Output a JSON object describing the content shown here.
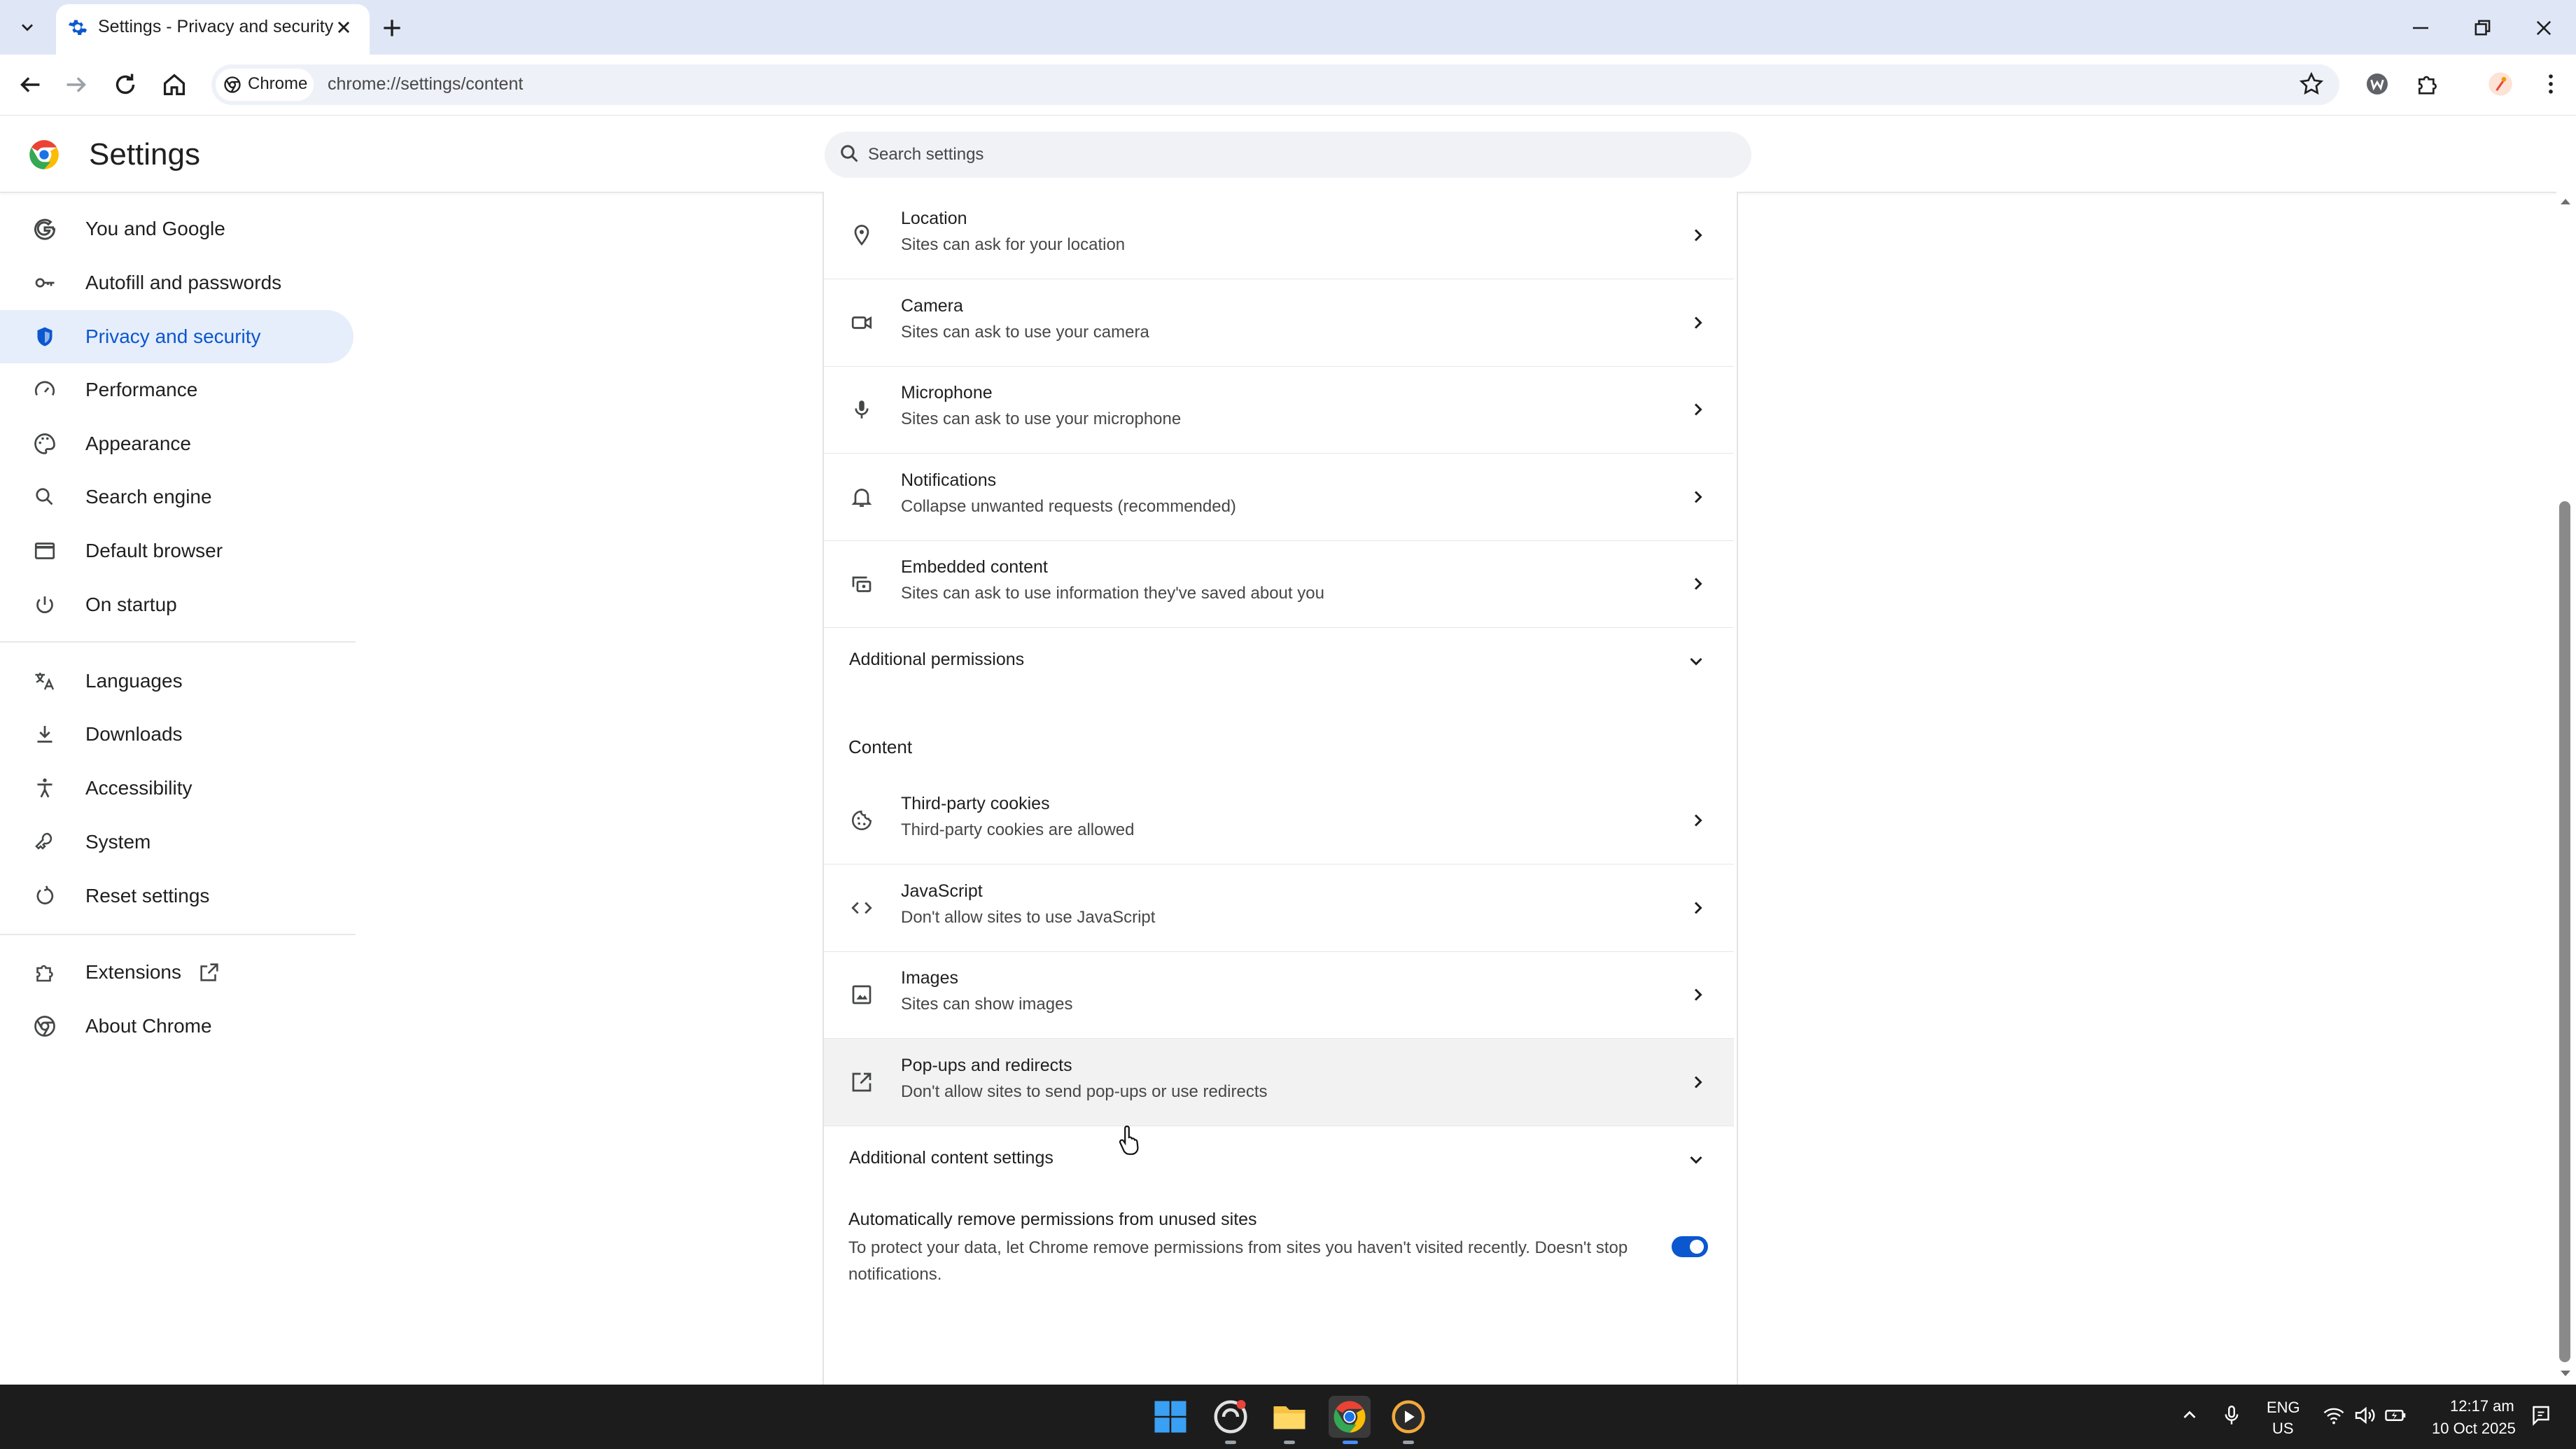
{
  "browser": {
    "tab_title": "Settings - Privacy and security",
    "chip_label": "Chrome",
    "url": "chrome://settings/content"
  },
  "header": {
    "title": "Settings",
    "search_placeholder": "Search settings"
  },
  "sidebar": {
    "items": [
      {
        "label": "You and Google",
        "icon": "google-g-icon"
      },
      {
        "label": "Autofill and passwords",
        "icon": "key-icon"
      },
      {
        "label": "Privacy and security",
        "icon": "shield-icon",
        "active": true
      },
      {
        "label": "Performance",
        "icon": "speedometer-icon"
      },
      {
        "label": "Appearance",
        "icon": "palette-icon"
      },
      {
        "label": "Search engine",
        "icon": "search-icon"
      },
      {
        "label": "Default browser",
        "icon": "browser-window-icon"
      },
      {
        "label": "On startup",
        "icon": "power-icon"
      },
      {
        "label": "Languages",
        "icon": "translate-icon"
      },
      {
        "label": "Downloads",
        "icon": "download-icon"
      },
      {
        "label": "Accessibility",
        "icon": "accessibility-icon"
      },
      {
        "label": "System",
        "icon": "wrench-icon"
      },
      {
        "label": "Reset settings",
        "icon": "reset-icon"
      },
      {
        "label": "Extensions",
        "icon": "puzzle-icon"
      },
      {
        "label": "About Chrome",
        "icon": "chrome-icon"
      }
    ]
  },
  "permissions": [
    {
      "title": "Location",
      "subtitle": "Sites can ask for your location",
      "icon": "location-pin-icon"
    },
    {
      "title": "Camera",
      "subtitle": "Sites can ask to use your camera",
      "icon": "camera-icon"
    },
    {
      "title": "Microphone",
      "subtitle": "Sites can ask to use your microphone",
      "icon": "microphone-icon"
    },
    {
      "title": "Notifications",
      "subtitle": "Collapse unwanted requests (recommended)",
      "icon": "bell-icon"
    },
    {
      "title": "Embedded content",
      "subtitle": "Sites can ask to use information they've saved about you",
      "icon": "embedded-content-icon"
    }
  ],
  "additional_permissions": "Additional permissions",
  "content_section_title": "Content",
  "content": [
    {
      "title": "Third-party cookies",
      "subtitle": "Third-party cookies are allowed",
      "icon": "cookie-icon"
    },
    {
      "title": "JavaScript",
      "subtitle": "Don't allow sites to use JavaScript",
      "icon": "code-icon"
    },
    {
      "title": "Images",
      "subtitle": "Sites can show images",
      "icon": "image-icon"
    },
    {
      "title": "Pop-ups and redirects",
      "subtitle": "Don't allow sites to send pop-ups or use redirects",
      "icon": "popup-icon"
    }
  ],
  "additional_content_settings": "Additional content settings",
  "auto_remove": {
    "title": "Automatically remove permissions from unused sites",
    "description": "To protect your data, let Chrome remove permissions from sites you haven't visited recently. Doesn't stop notifications.",
    "enabled": true
  },
  "taskbar": {
    "lang_line1": "ENG",
    "lang_line2": "US",
    "time": "12:17 am",
    "date": "10 Oct 2025"
  },
  "colors": {
    "accent": "#0b57d0",
    "active_nav_bg": "#e6eefb",
    "tabstrip": "#dfe7f7"
  }
}
